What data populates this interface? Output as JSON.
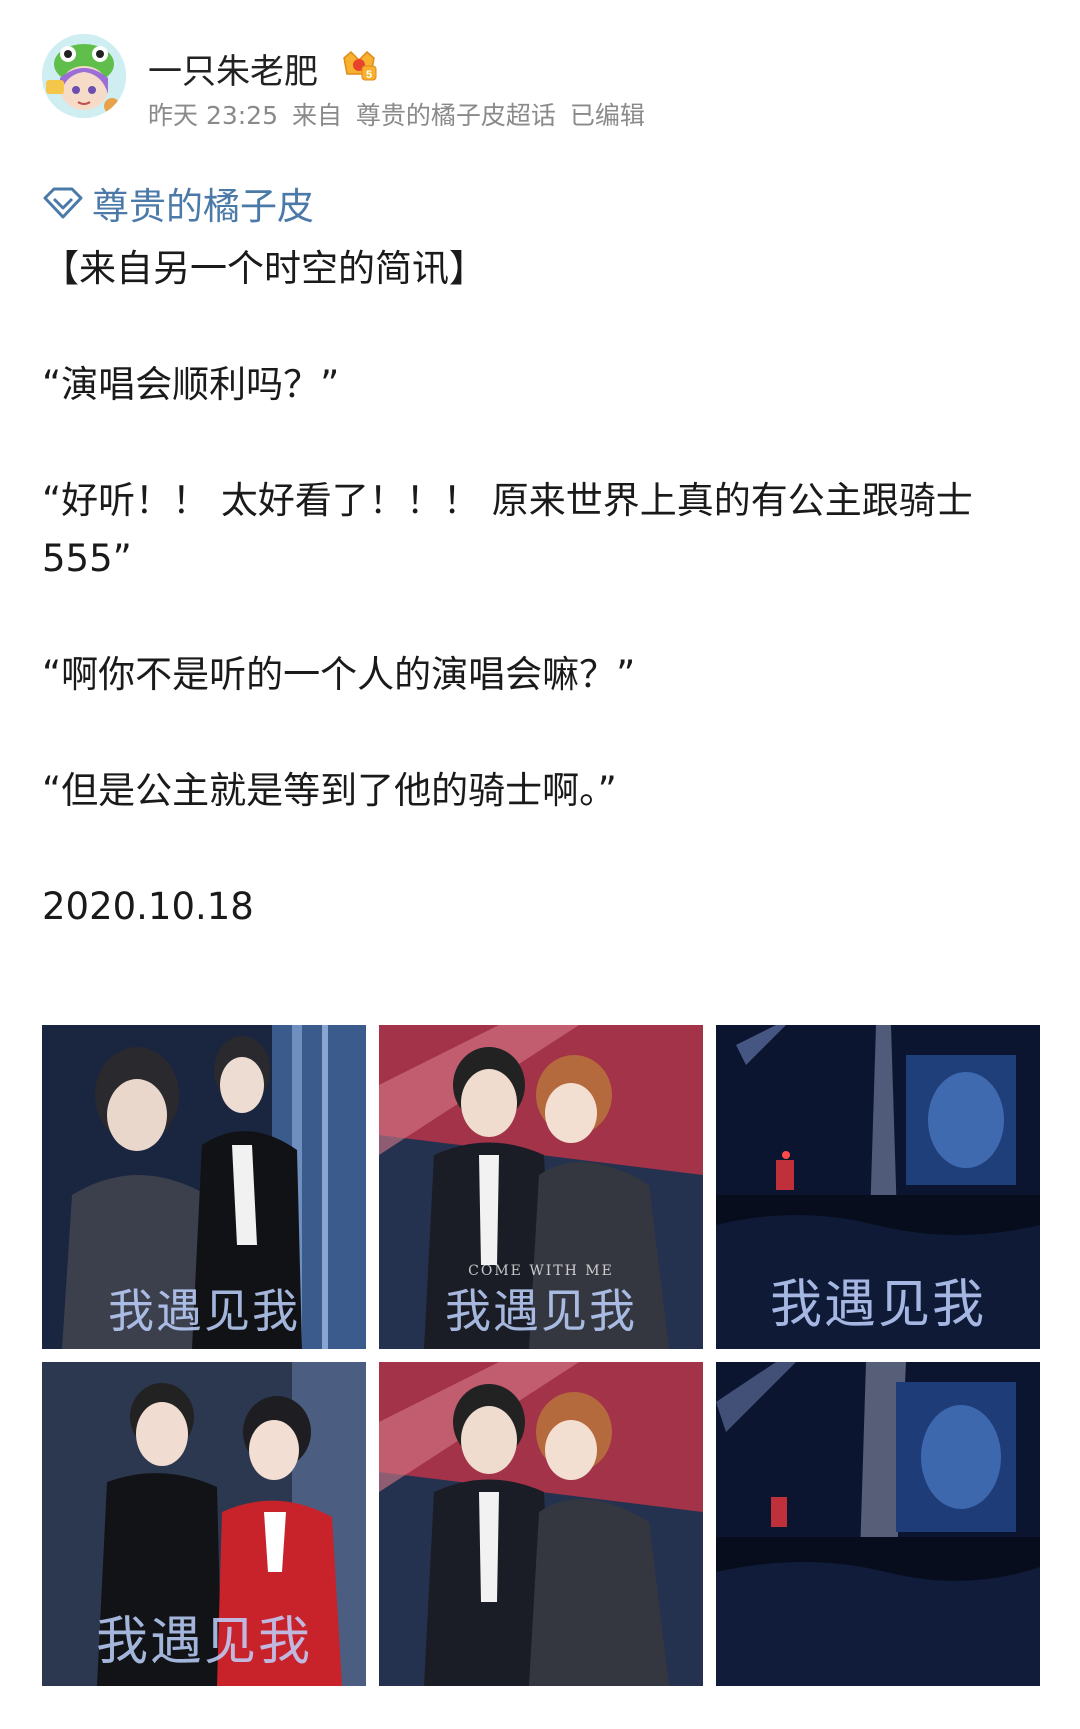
{
  "post": {
    "author": "一只朱老肥",
    "meta": {
      "time": "昨天 23:25",
      "source_prefix": "来自",
      "source": "尊贵的橘子皮超话",
      "edited": "已编辑"
    },
    "topic": "尊贵的橘子皮",
    "paragraphs": [
      "【来自另一个时空的简讯】",
      "“演唱会顺利吗？”",
      "“好听！！ 太好看了！！！ 原来世界上真的有公主跟骑士555”",
      "“啊你不是听的一个人的演唱会嘛？”",
      "“但是公主就是等到了他的骑士啊。”",
      "2020.10.18"
    ]
  },
  "photos": [
    {
      "caption": "我遇见我",
      "sub": ""
    },
    {
      "caption": "我遇见我",
      "sub": "COME WITH ME"
    },
    {
      "caption": "我遇见我",
      "sub": ""
    },
    {
      "caption": "我遇见我",
      "sub": ""
    },
    {
      "caption": "",
      "sub": ""
    },
    {
      "caption": "",
      "sub": ""
    }
  ],
  "colors": {
    "topic": "#4c7aa8",
    "meta": "#8a8a8a",
    "text": "#1a1a1a"
  },
  "icons": {
    "topic": "diamond-icon",
    "badge": "crown-badge-icon"
  }
}
